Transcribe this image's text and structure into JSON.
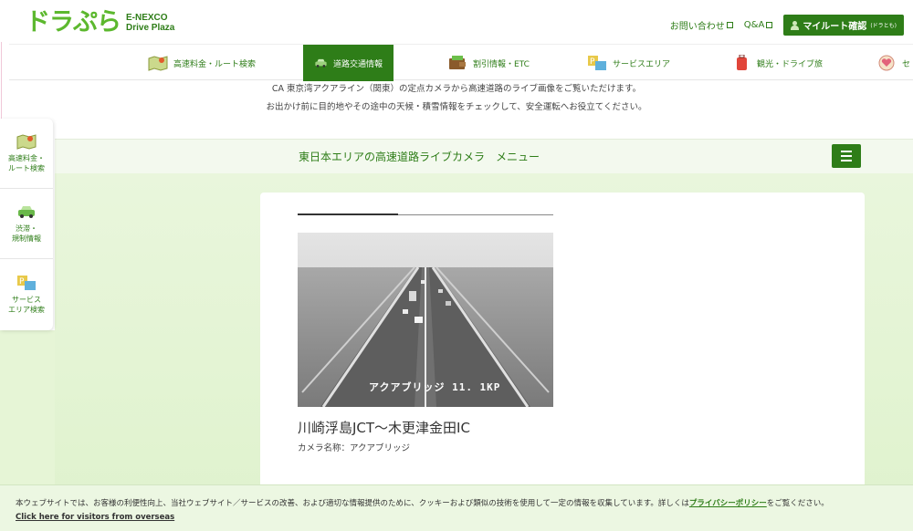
{
  "header": {
    "logo_main": "ドラぷら",
    "logo_sub1": "E-NEXCO",
    "logo_sub2": "Drive Plaza",
    "contact": "お問い合わせ",
    "qa": "Q&A",
    "mylog": "マイルート確認",
    "mylog_small": "(ドラとも)"
  },
  "nav": {
    "items": [
      {
        "label": "高速料金・ルート検索",
        "icon": "map-icon"
      },
      {
        "label": "道路交通情報",
        "icon": "car-icon"
      },
      {
        "label": "割引情報・ETC",
        "icon": "wallet-icon"
      },
      {
        "label": "サービスエリア",
        "icon": "parking-icon"
      },
      {
        "label": "観光・ドライブ旅",
        "icon": "suitcase-icon"
      },
      {
        "label": "セ",
        "icon": "heart-icon"
      }
    ]
  },
  "intro": {
    "line1": "CA 東京湾アクアライン（関東）の定点カメラから高速道路のライブ画像をご覧いただけます。",
    "line2": "お出かけ前に目的地やその途中の天候・積雪情報をチェックして、安全運転へお役立てください。"
  },
  "side": {
    "items": [
      {
        "line1": "高速料金・",
        "line2": "ルート検索"
      },
      {
        "line1": "渋滞・",
        "line2": "規制情報"
      },
      {
        "line1": "サービス",
        "line2": "エリア検索"
      }
    ]
  },
  "menubar": {
    "title": "東日本エリアの高速道路ライブカメラ　メニュー"
  },
  "camera": {
    "caption": "アクアブリッジ 11. 1KP",
    "title": "川崎浮島JCT～木更津金田IC",
    "name": "カメラ名称：アクアブリッジ"
  },
  "cookie": {
    "text_before": "本ウェブサイトでは、お客様の利便性向上、当社ウェブサイト／サービスの改善、および適切な情報提供のために、クッキーおよび類似の技術を使用して一定の情報を収集しています。詳しくは",
    "policy_link": "プライバシーポリシー",
    "text_after": "をご覧ください。",
    "overseas_link": "Click here for visitors from overseas"
  },
  "colors": {
    "brand_green": "#2e7d18",
    "logo_green": "#5cb82e",
    "bg_light_green": "#e9f6dc"
  }
}
